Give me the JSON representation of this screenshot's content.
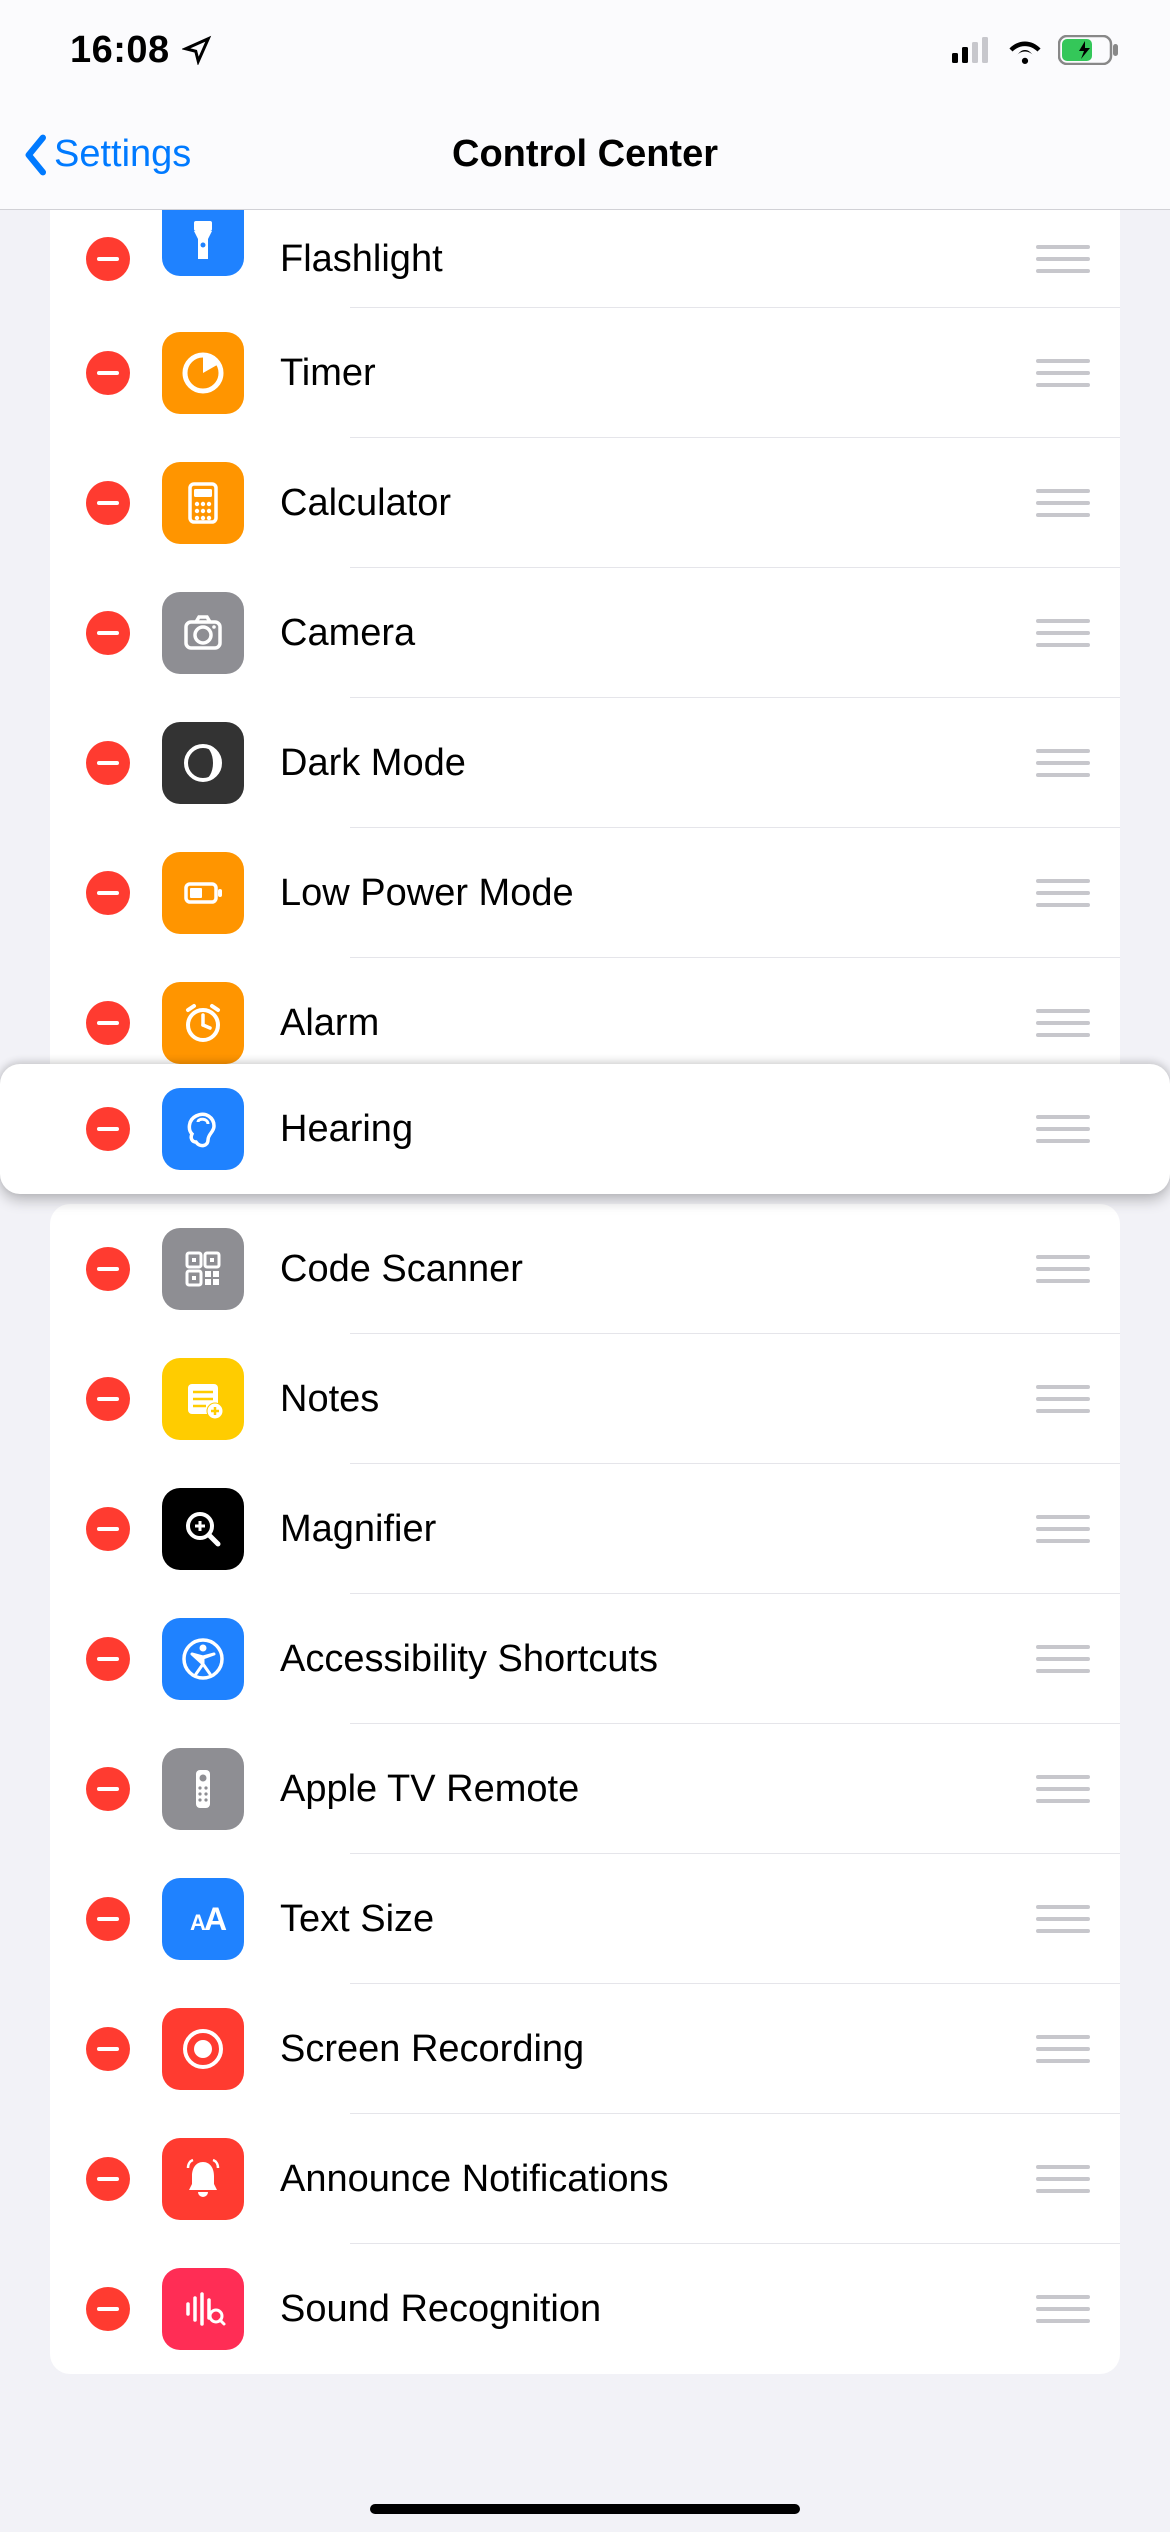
{
  "status": {
    "time": "16:08"
  },
  "nav": {
    "back_label": "Settings",
    "title": "Control Center"
  },
  "groups": [
    {
      "id": "g1",
      "floating": false,
      "topCut": true,
      "rows": [
        {
          "label": "Flashlight",
          "icon": "flashlight",
          "bg": "bg-blue"
        },
        {
          "label": "Timer",
          "icon": "timer",
          "bg": "bg-orange"
        },
        {
          "label": "Calculator",
          "icon": "calculator",
          "bg": "bg-orange"
        },
        {
          "label": "Camera",
          "icon": "camera",
          "bg": "bg-gray"
        },
        {
          "label": "Dark Mode",
          "icon": "darkmode",
          "bg": "bg-darkgray"
        },
        {
          "label": "Low Power Mode",
          "icon": "battery",
          "bg": "bg-orange"
        },
        {
          "label": "Alarm",
          "icon": "alarm",
          "bg": "bg-orange"
        }
      ]
    },
    {
      "id": "g-float",
      "floating": true,
      "rows": [
        {
          "label": "Hearing",
          "icon": "ear",
          "bg": "bg-blue"
        }
      ]
    },
    {
      "id": "g2",
      "floating": false,
      "rows": [
        {
          "label": "Code Scanner",
          "icon": "qrcode",
          "bg": "bg-gray"
        },
        {
          "label": "Notes",
          "icon": "notes",
          "bg": "bg-yellow"
        },
        {
          "label": "Magnifier",
          "icon": "magnifier",
          "bg": "bg-black"
        },
        {
          "label": "Accessibility Shortcuts",
          "icon": "accessibility",
          "bg": "bg-blue"
        },
        {
          "label": "Apple TV Remote",
          "icon": "remote",
          "bg": "bg-gray"
        },
        {
          "label": "Text Size",
          "icon": "textsize",
          "bg": "bg-blue"
        },
        {
          "label": "Screen Recording",
          "icon": "record",
          "bg": "bg-red"
        },
        {
          "label": "Announce Notifications",
          "icon": "bell",
          "bg": "bg-red"
        },
        {
          "label": "Sound Recognition",
          "icon": "waveform",
          "bg": "bg-pink"
        }
      ]
    }
  ]
}
